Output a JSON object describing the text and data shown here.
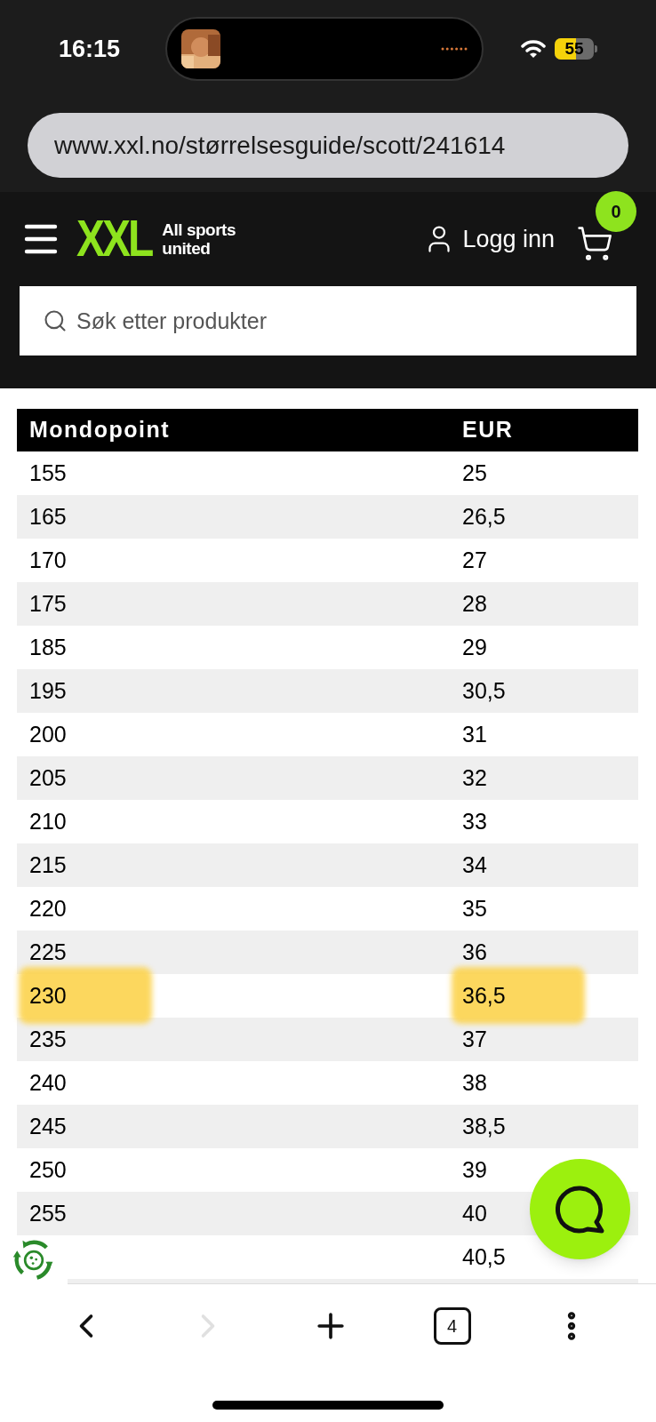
{
  "status_bar": {
    "time": "16:15",
    "battery": "55"
  },
  "address_bar": {
    "url": "www.xxl.no/størrelsesguide/scott/241614"
  },
  "header": {
    "logo": "XXL",
    "tagline_lines": [
      "All sports",
      "united"
    ],
    "login": "Logg inn",
    "cart_count": "0"
  },
  "search": {
    "placeholder": "Søk etter produkter"
  },
  "table": {
    "columns": [
      "Mondopoint",
      "EUR"
    ],
    "rows": [
      {
        "mondopoint": "155",
        "eur": "25",
        "highlighted": false
      },
      {
        "mondopoint": "165",
        "eur": "26,5",
        "highlighted": false
      },
      {
        "mondopoint": "170",
        "eur": "27",
        "highlighted": false
      },
      {
        "mondopoint": "175",
        "eur": "28",
        "highlighted": false
      },
      {
        "mondopoint": "185",
        "eur": "29",
        "highlighted": false
      },
      {
        "mondopoint": "195",
        "eur": "30,5",
        "highlighted": false
      },
      {
        "mondopoint": "200",
        "eur": "31",
        "highlighted": false
      },
      {
        "mondopoint": "205",
        "eur": "32",
        "highlighted": false
      },
      {
        "mondopoint": "210",
        "eur": "33",
        "highlighted": false
      },
      {
        "mondopoint": "215",
        "eur": "34",
        "highlighted": false
      },
      {
        "mondopoint": "220",
        "eur": "35",
        "highlighted": false
      },
      {
        "mondopoint": "225",
        "eur": "36",
        "highlighted": false
      },
      {
        "mondopoint": "230",
        "eur": "36,5",
        "highlighted": true
      },
      {
        "mondopoint": "235",
        "eur": "37",
        "highlighted": false
      },
      {
        "mondopoint": "240",
        "eur": "38",
        "highlighted": false
      },
      {
        "mondopoint": "245",
        "eur": "38,5",
        "highlighted": false
      },
      {
        "mondopoint": "250",
        "eur": "39",
        "highlighted": false
      },
      {
        "mondopoint": "255",
        "eur": "40",
        "highlighted": false
      },
      {
        "eur": "40,5",
        "highlighted": false
      }
    ]
  },
  "toolbar": {
    "forward_disabled": true,
    "tab_count": "4"
  }
}
